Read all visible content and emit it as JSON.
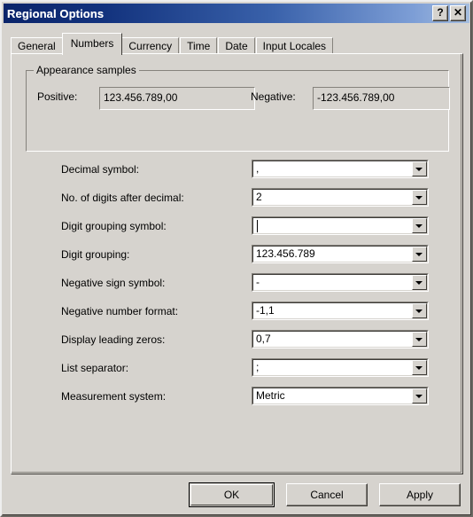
{
  "window": {
    "title": "Regional Options",
    "help_button": "?",
    "close_button": "✕"
  },
  "tabs": [
    {
      "label": "General",
      "selected": false
    },
    {
      "label": "Numbers",
      "selected": true
    },
    {
      "label": "Currency",
      "selected": false
    },
    {
      "label": "Time",
      "selected": false
    },
    {
      "label": "Date",
      "selected": false
    },
    {
      "label": "Input Locales",
      "selected": false
    }
  ],
  "appearance_samples": {
    "legend": "Appearance samples",
    "positive_label": "Positive:",
    "positive_value": "123.456.789,00",
    "negative_label": "Negative:",
    "negative_value": "-123.456.789,00"
  },
  "settings": [
    {
      "label": "Decimal symbol:",
      "value": ","
    },
    {
      "label": "No. of digits after decimal:",
      "value": "2"
    },
    {
      "label": "Digit grouping symbol:",
      "value": ""
    },
    {
      "label": "Digit grouping:",
      "value": "123.456.789"
    },
    {
      "label": "Negative sign symbol:",
      "value": "-"
    },
    {
      "label": "Negative number format:",
      "value": "-1,1"
    },
    {
      "label": "Display leading zeros:",
      "value": "0,7"
    },
    {
      "label": "List separator:",
      "value": ";"
    },
    {
      "label": "Measurement system:",
      "value": "Metric"
    }
  ],
  "buttons": {
    "ok": "OK",
    "cancel": "Cancel",
    "apply": "Apply"
  },
  "colors": {
    "dialog_face": "#d6d3ce",
    "title_gradient_start": "#0a246a",
    "title_gradient_end": "#a6bedf",
    "field_background": "#ffffff"
  }
}
